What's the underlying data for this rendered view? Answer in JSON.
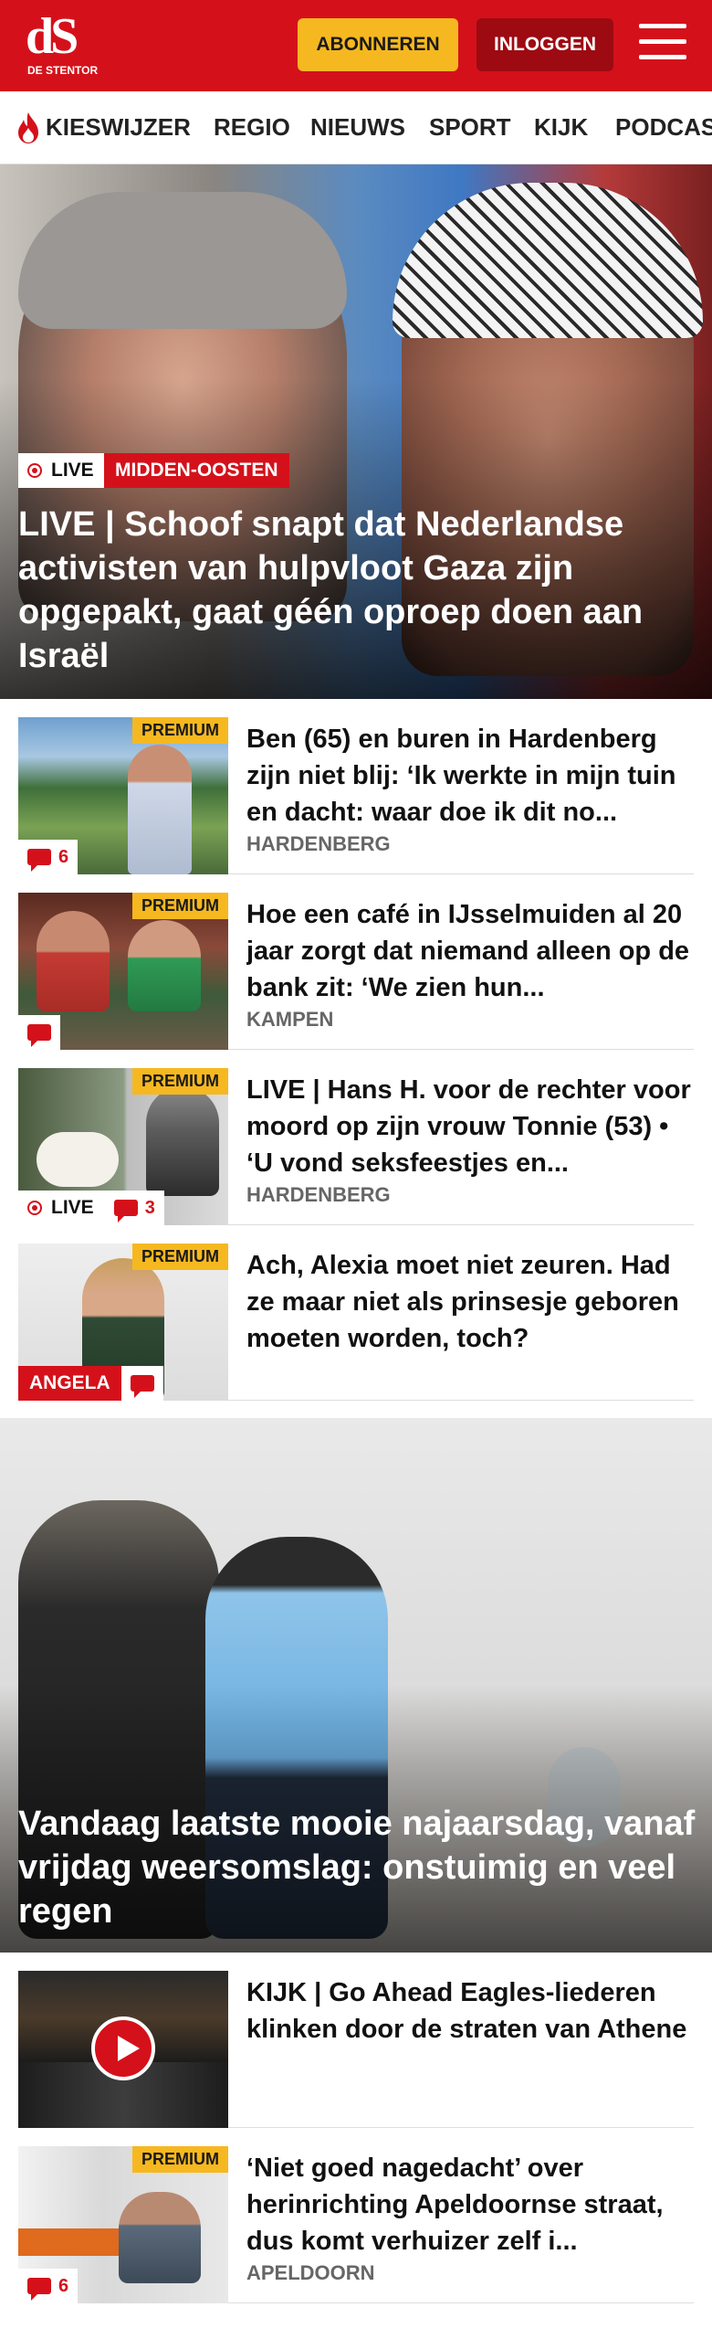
{
  "header": {
    "logo_text": "dS",
    "logo_name": "DE STENTOR",
    "subscribe_label": "ABONNEREN",
    "login_label": "INLOGGEN",
    "brand_color": "#d4111b"
  },
  "nav": {
    "items": [
      {
        "label": "KIESWIJZER",
        "icon": "flame-icon"
      },
      {
        "label": "REGIO"
      },
      {
        "label": "NIEUWS"
      },
      {
        "label": "SPORT"
      },
      {
        "label": "KIJK"
      },
      {
        "label": "PODCAS"
      }
    ]
  },
  "hero1": {
    "live_label": "LIVE",
    "tag": "MIDDEN-OOSTEN",
    "title": "LIVE | Schoof snapt dat Nederlandse activisten van hulpvloot Gaza zijn opgepakt, gaat géén oproep doen aan Israël"
  },
  "articles": [
    {
      "premium": "PREMIUM",
      "comments": "6",
      "title": "Ben (65) en buren in Hardenberg zijn niet blij: ‘Ik werkte in mijn tuin en dacht: waar doe ik dit no...",
      "location": "HARDENBERG"
    },
    {
      "premium": "PREMIUM",
      "comments": "",
      "title": "Hoe een café in IJsselmuiden al 20 jaar zorgt dat niemand alleen op de bank zit: ‘We zien hun...",
      "location": "KAMPEN"
    },
    {
      "premium": "PREMIUM",
      "live_label": "LIVE",
      "comments": "3",
      "title": "LIVE | Hans H. voor de rechter voor moord op zijn vrouw Tonnie (53) • ‘U vond seksfeestjes en...",
      "location": "HARDENBERG"
    },
    {
      "premium": "PREMIUM",
      "author_tag": "ANGELA",
      "comments": "",
      "title": "Ach, Alexia moet niet zeuren. Had ze maar niet als prinsesje geboren moeten worden, toch?",
      "location": ""
    }
  ],
  "hero2": {
    "title": "Vandaag laatste mooie najaarsdag, vanaf vrijdag weersomslag: onstuimig en veel regen"
  },
  "articles2": [
    {
      "title": "KIJK | Go Ahead Eagles-liederen klinken door de straten van Athene",
      "location": "",
      "icon": "play-icon"
    },
    {
      "premium": "PREMIUM",
      "comments": "6",
      "title": "‘Niet goed nagedacht’ over herinrichting Apeldoornse straat, dus komt verhuizer zelf i...",
      "location": "APELDOORN"
    }
  ]
}
